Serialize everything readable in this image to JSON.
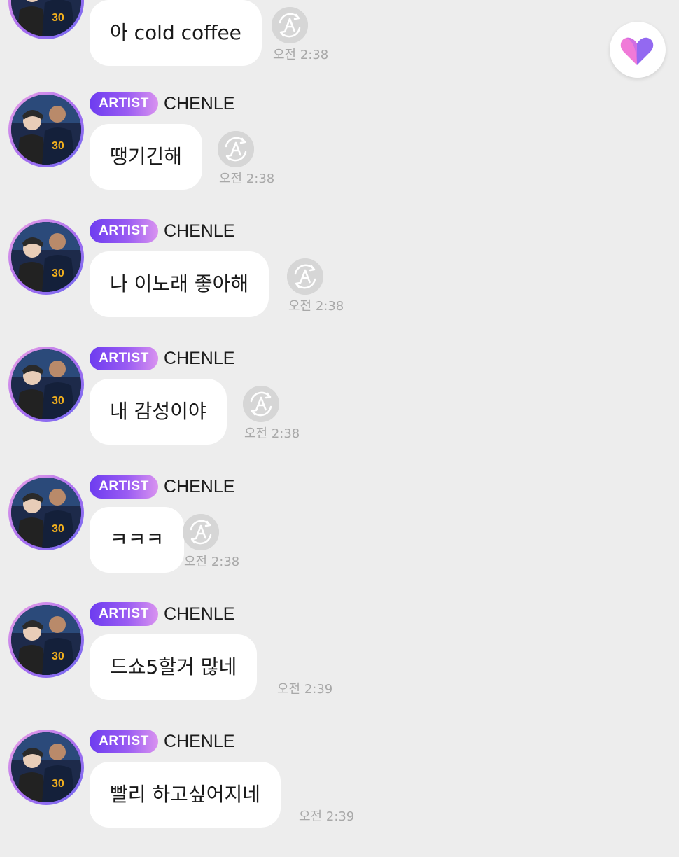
{
  "colors": {
    "background": "#ededed",
    "bubble": "#ffffff",
    "artist_badge_start": "#6d3cf0",
    "artist_badge_end": "#d993f0",
    "timestamp": "#a8a8a8",
    "translate_button": "#d6d6d6",
    "heart_pink": "#f07ad8",
    "heart_purple": "#8a5cf0"
  },
  "heart_button": {
    "icon": "heart-icon"
  },
  "translate_icon": "translate-a-icon",
  "messages": [
    {
      "badge": "",
      "author": "",
      "text": "아 cold coffee",
      "time": "오전 2:38"
    },
    {
      "badge": "ARTIST",
      "author": "CHENLE",
      "text": "땡기긴해",
      "time": "오전 2:38"
    },
    {
      "badge": "ARTIST",
      "author": "CHENLE",
      "text": "나 이노래 좋아해",
      "time": "오전 2:38"
    },
    {
      "badge": "ARTIST",
      "author": "CHENLE",
      "text": "내 감성이야",
      "time": "오전 2:38"
    },
    {
      "badge": "ARTIST",
      "author": "CHENLE",
      "text": "ㅋㅋㅋ",
      "time": "오전 2:38"
    },
    {
      "badge": "ARTIST",
      "author": "CHENLE",
      "text": "드쇼5할거 많네",
      "time": "오전 2:39"
    },
    {
      "badge": "ARTIST",
      "author": "CHENLE",
      "text": "빨리 하고싶어지네",
      "time": "오전 2:39"
    }
  ]
}
